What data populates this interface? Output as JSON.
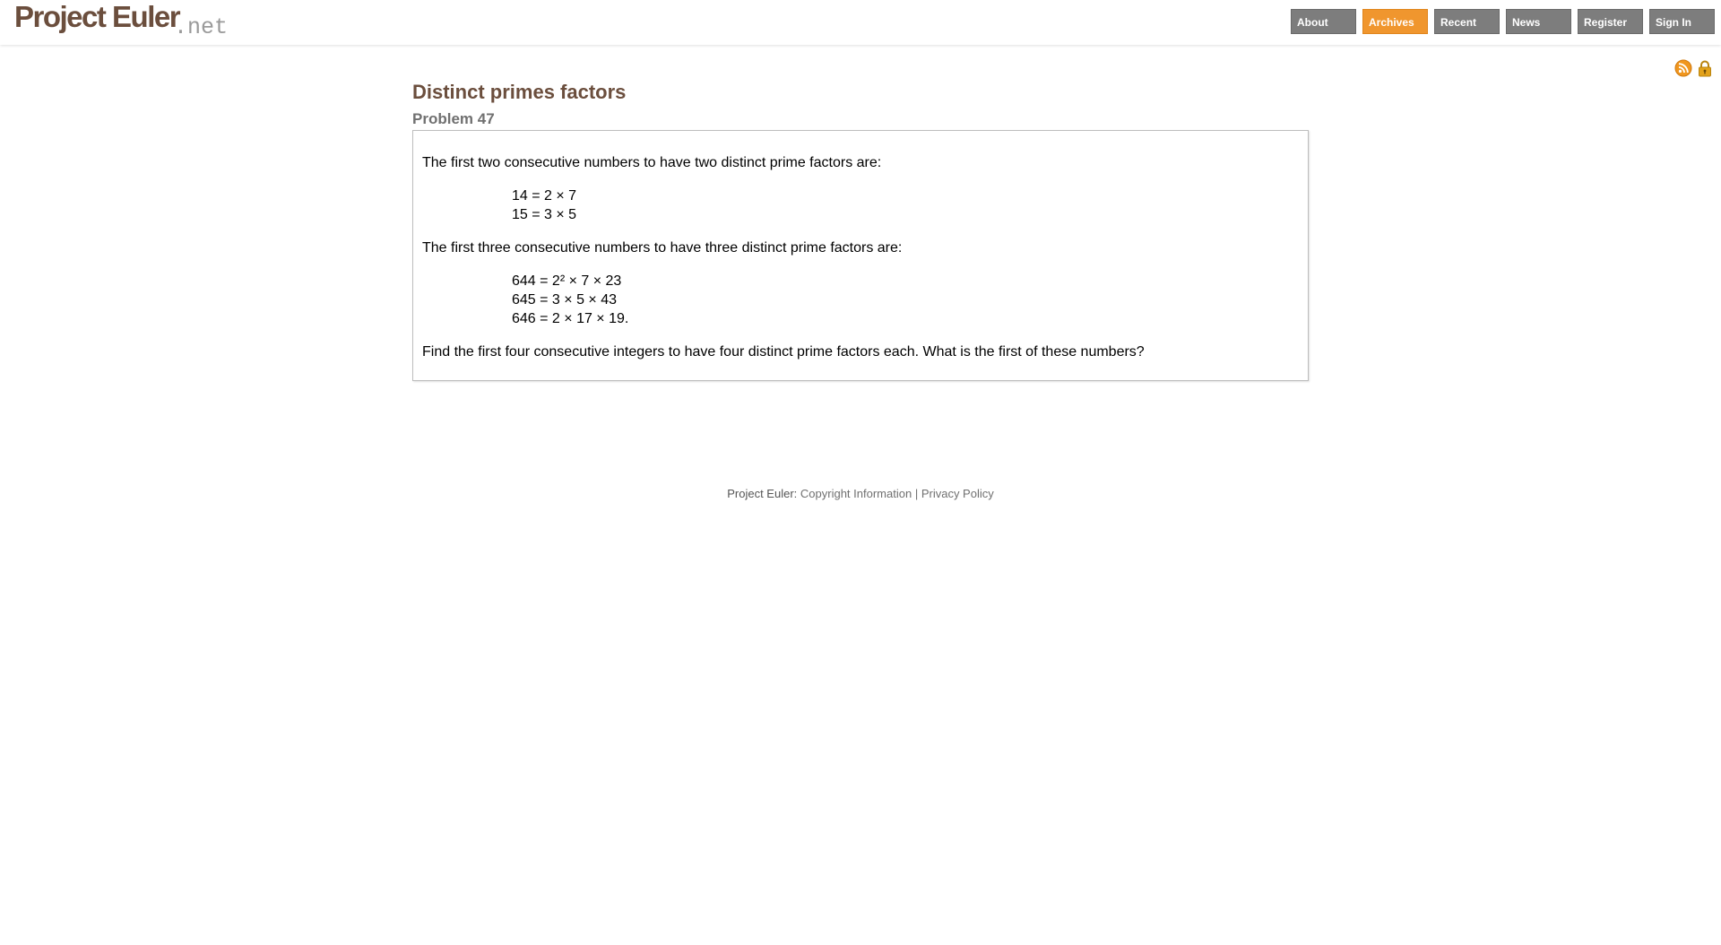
{
  "brand": {
    "name": "Project Euler",
    "suffix": ".net"
  },
  "nav": {
    "items": [
      {
        "label": "About"
      },
      {
        "label": "Archives"
      },
      {
        "label": "Recent"
      },
      {
        "label": "News"
      },
      {
        "label": "Register"
      },
      {
        "label": "Sign In"
      }
    ],
    "active": "Archives"
  },
  "tools": {
    "icons": [
      "rss-icon",
      "lock-icon"
    ]
  },
  "problem": {
    "title": "Distinct primes factors",
    "subtitle": "Problem 47",
    "intro_two": "The first two consecutive numbers to have two distinct prime factors are:",
    "two_lines": [
      "14 = 2 × 7",
      "15 = 3 × 5"
    ],
    "intro_three": "The first three consecutive numbers to have three distinct prime factors are:",
    "three_lines": [
      "644 = 2² × 7 × 23",
      "645 = 3 × 5 × 43",
      "646 = 2 × 17 × 19."
    ],
    "question": "Find the first four consecutive integers to have four distinct prime factors each. What is the first of these numbers?"
  },
  "footer": {
    "label": "Project Euler:",
    "copyright": "Copyright Information",
    "separator": "|",
    "privacy": "Privacy Policy"
  },
  "colors": {
    "brand_brown": "#6b4e3d",
    "nav_gray": "#7d7d7d",
    "nav_active": "#f0962e",
    "rss_orange": "#f0961e",
    "lock_gold": "#e3a21a"
  }
}
